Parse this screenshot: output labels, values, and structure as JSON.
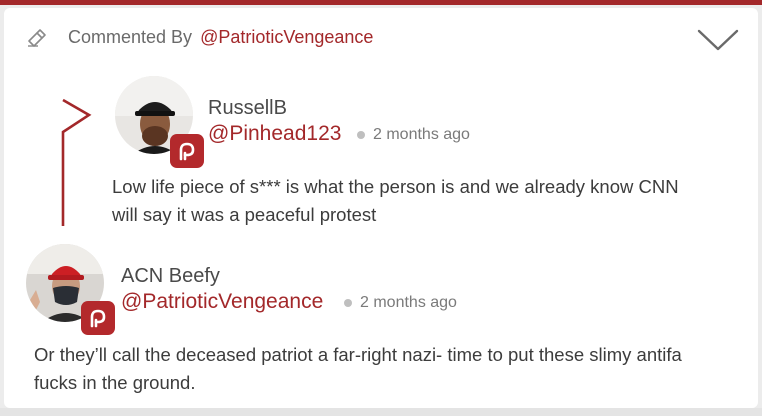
{
  "header": {
    "label": "Commented By",
    "user": "@PatrioticVengeance",
    "left_icon": "comment-eraser-icon",
    "right_icon": "chevron-down-icon"
  },
  "colors": {
    "accent": "#a3282a",
    "background": "#ececec",
    "card": "#ffffff"
  },
  "reply": {
    "display_name": "RussellB",
    "handle": "@Pinhead123",
    "time": "2 months ago",
    "text": "Low life piece of s*** is what the person is and we already know CNN will say it was a peaceful protest",
    "badge_icon": "parler-logo-icon"
  },
  "comment": {
    "display_name": "ACN Beefy",
    "handle": "@PatrioticVengeance",
    "time": "2 months ago",
    "text": "Or they’ll call the deceased patriot a far-right nazi- time to put these slimy antifa fucks in the ground.",
    "badge_icon": "parler-logo-icon"
  }
}
